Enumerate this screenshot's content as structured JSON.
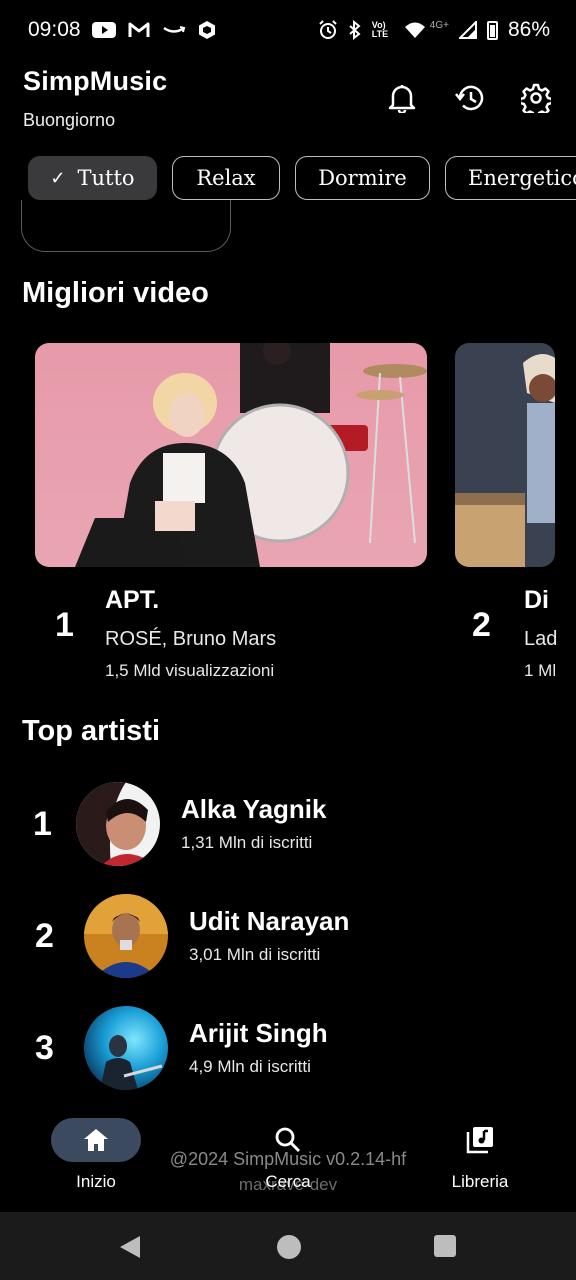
{
  "status_bar": {
    "time": "09:08",
    "left_icons": [
      "youtube-icon",
      "gmail-icon",
      "amazon-icon",
      "hexagon-app-icon"
    ],
    "right_icons": [
      "alarm-icon",
      "bluetooth-icon",
      "volte-icon",
      "wifi-icon",
      "network-4g-icon",
      "signal-icon",
      "battery-icon"
    ],
    "volte_label": "Vo) LTE",
    "network_label": "4G+",
    "battery": "86%"
  },
  "header": {
    "title": "SimpMusic",
    "greeting": "Buongiorno",
    "icons": [
      "bell-icon",
      "history-icon",
      "gear-icon"
    ]
  },
  "chips": [
    {
      "label": "Tutto",
      "selected": true
    },
    {
      "label": "Relax",
      "selected": false
    },
    {
      "label": "Dormire",
      "selected": false
    },
    {
      "label": "Energetico",
      "selected": false
    }
  ],
  "top_videos": {
    "title": "Migliori video",
    "items": [
      {
        "rank": "1",
        "title": "APT.",
        "artist": "ROSÉ, Bruno Mars",
        "views": "1,5 Mld visualizzazioni"
      },
      {
        "rank": "2",
        "title": "Di",
        "artist": "Lad",
        "views": "1 Ml"
      }
    ]
  },
  "top_artists": {
    "title": "Top artisti",
    "items": [
      {
        "rank": "1",
        "name": "Alka Yagnik",
        "subscribers": "1,31 Mln di iscritti"
      },
      {
        "rank": "2",
        "name": "Udit Narayan",
        "subscribers": "3,01 Mln di iscritti"
      },
      {
        "rank": "3",
        "name": "Arijit Singh",
        "subscribers": "4,9 Mln di iscritti"
      }
    ]
  },
  "footer": {
    "credit": "@2024 SimpMusic v0.2.14-hf",
    "author": "maxrave-dev"
  },
  "bottom_nav": {
    "items": [
      {
        "label": "Inizio",
        "icon": "home-icon",
        "active": true
      },
      {
        "label": "Cerca",
        "icon": "search-icon",
        "active": false
      },
      {
        "label": "Libreria",
        "icon": "library-icon",
        "active": false
      }
    ]
  },
  "system_nav": {
    "buttons": [
      "back-icon",
      "home-circle-icon",
      "recents-icon"
    ]
  }
}
